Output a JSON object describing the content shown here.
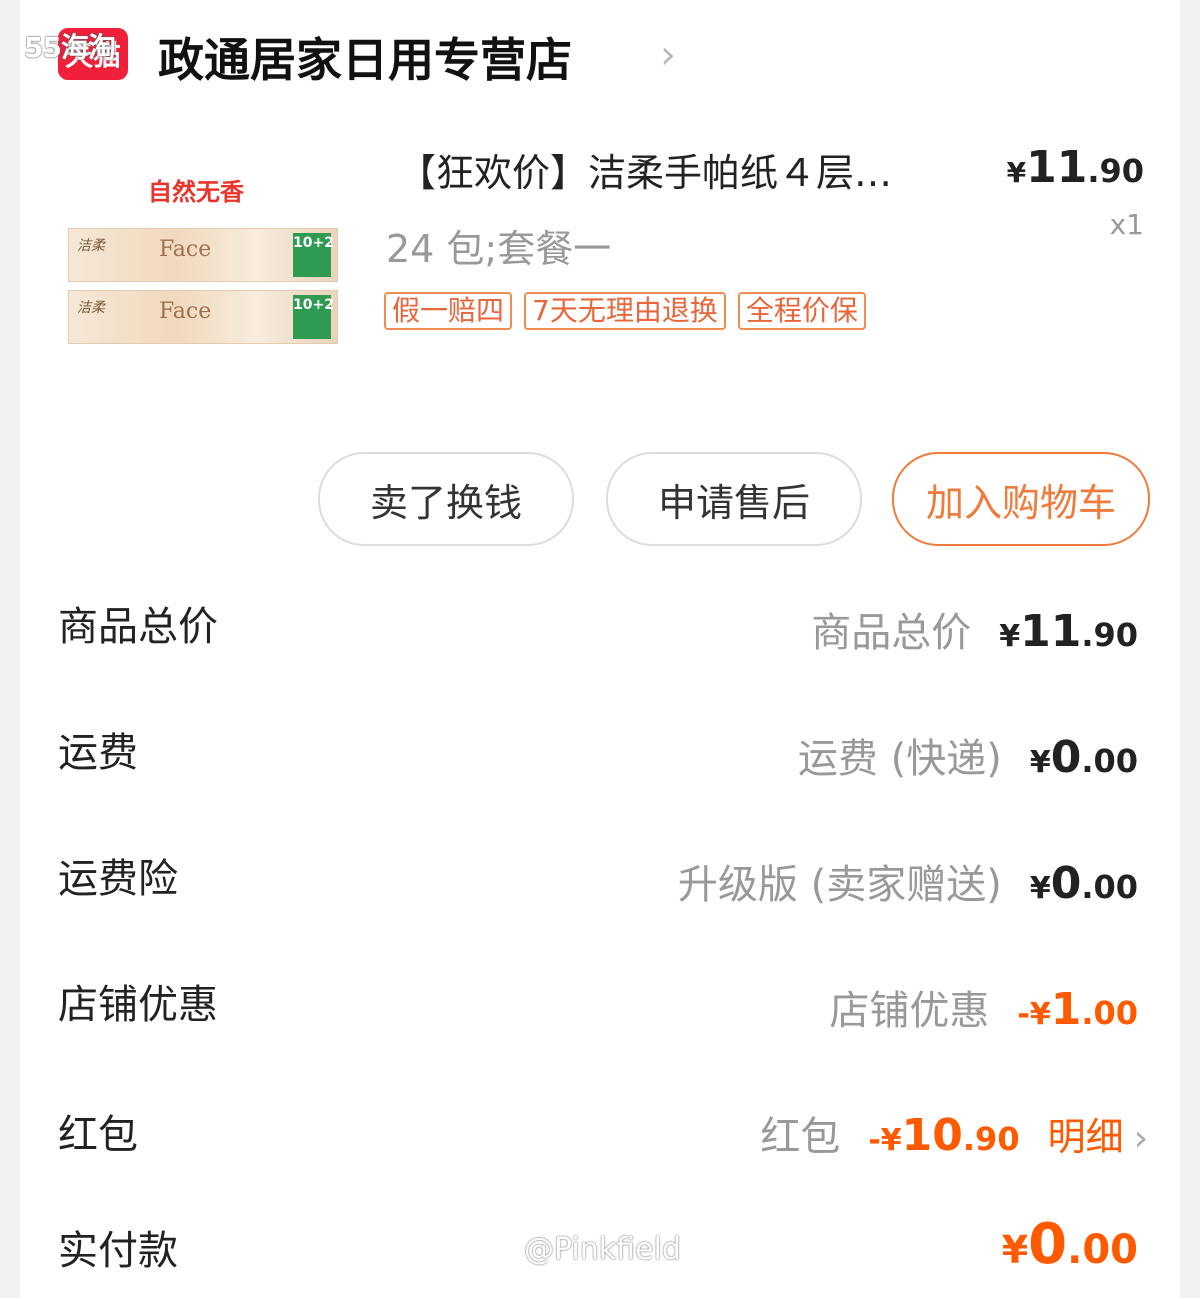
{
  "watermark_top": "55海淘",
  "header": {
    "logo_text": "天猫",
    "shop_name": "政通居家日用专营店",
    "chevron": "›"
  },
  "product": {
    "image_tag": "自然无香",
    "image_brand": "洁柔",
    "image_face": "Face",
    "image_badge": "10+2",
    "title": "【狂欢价】洁柔手帕纸４层…",
    "price_yen": "¥",
    "price_int": "11",
    "price_dec": ".90",
    "qty": "x1",
    "spec": "24 包;套餐一",
    "tags": [
      "假一赔四",
      "7天无理由退换",
      "全程价保"
    ]
  },
  "buttons": {
    "sell": "卖了换钱",
    "aftersale": "申请售后",
    "add_cart": "加入购物车"
  },
  "rows": {
    "goods_total": {
      "label": "商品总价",
      "desc": "商品总价",
      "yen": "¥",
      "int": "11",
      "dec": ".90"
    },
    "shipping": {
      "label": "运费",
      "desc": "运费 (快递)",
      "yen": "¥",
      "int": "0",
      "dec": ".00"
    },
    "insurance": {
      "label": "运费险",
      "desc": "升级版 (卖家赠送)",
      "yen": "¥",
      "int": "0",
      "dec": ".00"
    },
    "shop_discount": {
      "label": "店铺优惠",
      "desc": "店铺优惠",
      "prefix": "-",
      "yen": "¥",
      "int": "1",
      "dec": ".00"
    },
    "red_packet": {
      "label": "红包",
      "desc": "红包",
      "prefix": "-",
      "yen": "¥",
      "int": "10",
      "dec": ".90",
      "detail": "明细",
      "chevron": "›"
    },
    "paid": {
      "label": "实付款",
      "yen": "¥",
      "int": "0",
      "dec": ".00"
    }
  },
  "credit": "@Pinkfield",
  "colors": {
    "accent_orange": "#ff5a00",
    "tmall_red": "#f0203a",
    "tag_orange": "#e8663a"
  }
}
